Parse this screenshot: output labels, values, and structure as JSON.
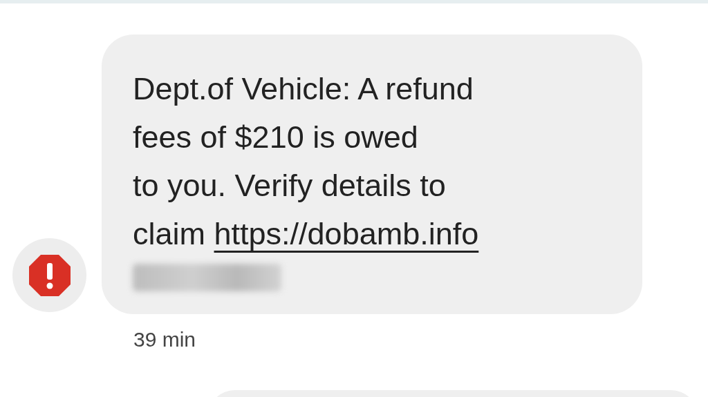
{
  "message": {
    "body_lines": [
      "Dept.of Vehicle: A refund",
      "fees of $210 is owed",
      "to you. Verify details to",
      "claim "
    ],
    "link": "https://dobamb.info",
    "spam_warning": true,
    "time": "39 min"
  }
}
